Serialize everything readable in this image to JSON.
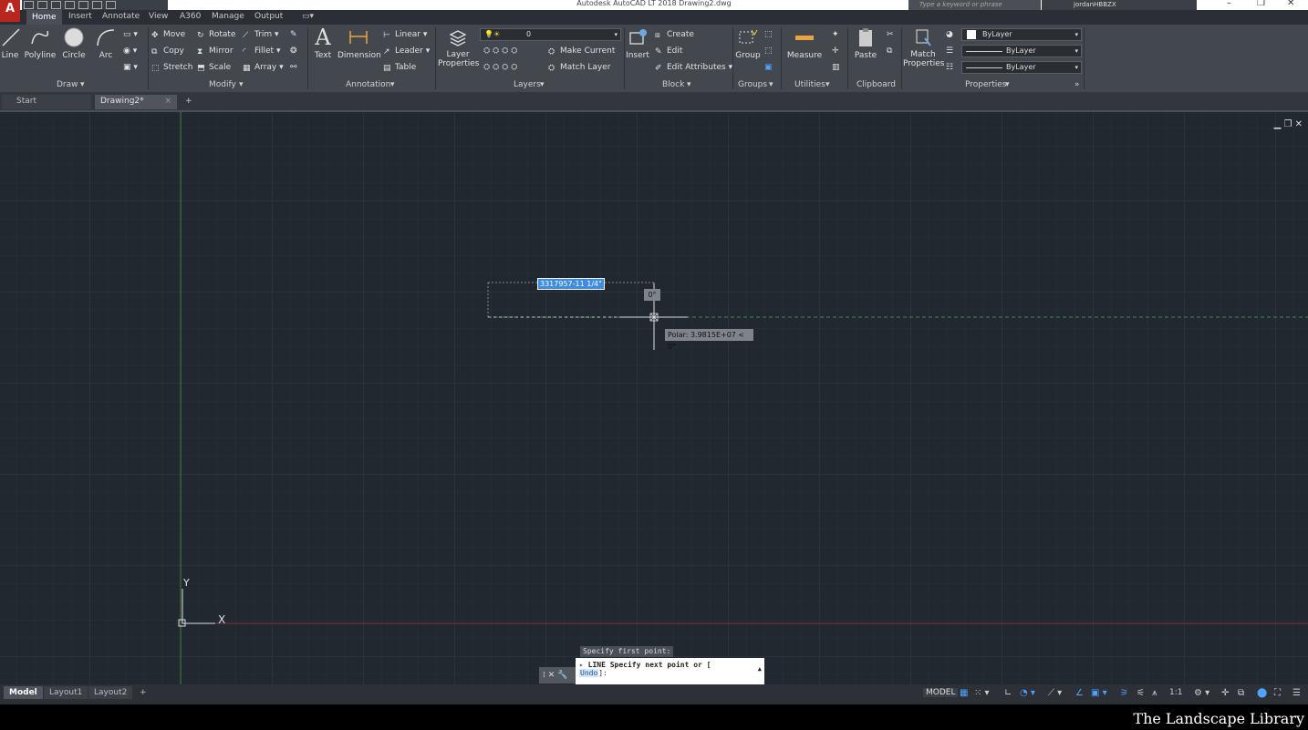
{
  "titlebar": {
    "app_letter": "A",
    "title": "Autodesk AutoCAD LT 2018    Drawing2.dwg",
    "search_placeholder": "Type a keyword or phrase",
    "username": "jordanHBBZX"
  },
  "ribbon_tabs": [
    "Home",
    "Insert",
    "Annotate",
    "View",
    "A360",
    "Manage",
    "Output"
  ],
  "ribbon": {
    "draw": {
      "title": "Draw",
      "line": "Line",
      "polyline": "Polyline",
      "circle": "Circle",
      "arc": "Arc"
    },
    "modify": {
      "title": "Modify",
      "move": "Move",
      "rotate": "Rotate",
      "trim": "Trim",
      "copy": "Copy",
      "mirror": "Mirror",
      "fillet": "Fillet",
      "stretch": "Stretch",
      "scale": "Scale",
      "array": "Array"
    },
    "annotation": {
      "title": "Annotation",
      "text": "Text",
      "dimension": "Dimension",
      "linear": "Linear",
      "leader": "Leader",
      "table": "Table"
    },
    "layers": {
      "title": "Layers",
      "layer_properties_1": "Layer",
      "layer_properties_2": "Properties",
      "current_layer": "0",
      "make_current": "Make Current",
      "match_layer": "Match Layer"
    },
    "block": {
      "title": "Block",
      "insert": "Insert",
      "create": "Create",
      "edit": "Edit",
      "edit_attributes": "Edit Attributes"
    },
    "groups": {
      "title": "Groups",
      "group": "Group"
    },
    "utilities": {
      "title": "Utilities",
      "measure": "Measure"
    },
    "clipboard": {
      "title": "Clipboard",
      "paste": "Paste"
    },
    "properties": {
      "title": "Properties",
      "match_1": "Match",
      "match_2": "Properties",
      "color": "ByLayer",
      "lineweight": "ByLayer",
      "linetype": "ByLayer"
    }
  },
  "doc_tabs": {
    "start": "Start",
    "drawing": "Drawing2*",
    "close": "×",
    "new": "+"
  },
  "canvas": {
    "dynamic_input": "3317957-11 1/4\"",
    "angle_tooltip": "0°",
    "polar_tooltip": "Polar: 3.9815E+07 < 0°",
    "previous_prompt": "Specify first point:",
    "ucs_y": "Y",
    "ucs_x": "X"
  },
  "command_line": {
    "prompt_line1": "LINE Specify next point or [",
    "undo_option": "Undo",
    "prompt_end": "]:"
  },
  "layout_tabs": [
    "Model",
    "Layout1",
    "Layout2"
  ],
  "layout_add": "+",
  "status": {
    "model": "MODEL",
    "scale": "1:1"
  },
  "watermark": "The Landscape Library"
}
